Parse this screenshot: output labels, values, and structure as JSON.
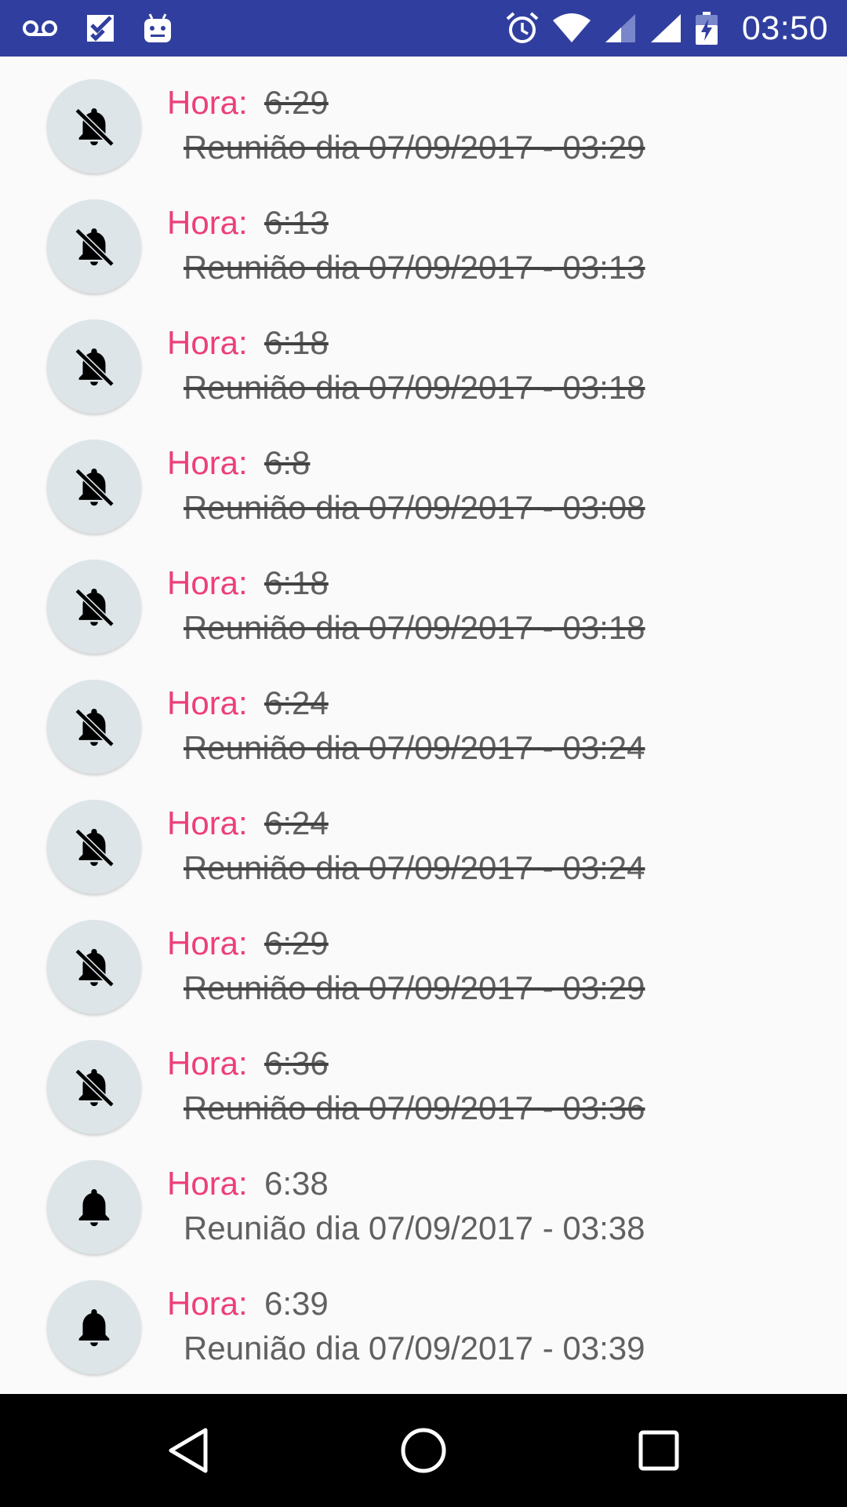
{
  "status_bar": {
    "time": "03:50",
    "left_icons": [
      "voicemail-icon",
      "checklist-icon",
      "android-icon"
    ],
    "right_icons": [
      "alarm-icon",
      "wifi-icon",
      "signal-icon",
      "signal-icon",
      "battery-charging-icon"
    ]
  },
  "colors": {
    "status_bar": "#303f9f",
    "label_accent": "#ec407a",
    "text": "#616161",
    "avatar_bg": "#dde5e8"
  },
  "list": {
    "items": [
      {
        "label": "Hora:",
        "time": "6:29",
        "description": "Reunião dia 07/09/2017 - 03:29",
        "notifications_off": true
      },
      {
        "label": "Hora:",
        "time": "6:13",
        "description": "Reunião dia 07/09/2017 - 03:13",
        "notifications_off": true
      },
      {
        "label": "Hora:",
        "time": "6:18",
        "description": "Reunião dia 07/09/2017 - 03:18",
        "notifications_off": true
      },
      {
        "label": "Hora:",
        "time": "6:8",
        "description": "Reunião dia 07/09/2017 - 03:08",
        "notifications_off": true
      },
      {
        "label": "Hora:",
        "time": "6:18",
        "description": "Reunião dia 07/09/2017 - 03:18",
        "notifications_off": true
      },
      {
        "label": "Hora:",
        "time": "6:24",
        "description": "Reunião dia 07/09/2017 - 03:24",
        "notifications_off": true
      },
      {
        "label": "Hora:",
        "time": "6:24",
        "description": "Reunião dia 07/09/2017 - 03:24",
        "notifications_off": true
      },
      {
        "label": "Hora:",
        "time": "6:29",
        "description": "Reunião dia 07/09/2017 - 03:29",
        "notifications_off": true
      },
      {
        "label": "Hora:",
        "time": "6:36",
        "description": "Reunião dia 07/09/2017 - 03:36",
        "notifications_off": true
      },
      {
        "label": "Hora:",
        "time": "6:38",
        "description": "Reunião dia 07/09/2017 - 03:38",
        "notifications_off": false
      },
      {
        "label": "Hora:",
        "time": "6:39",
        "description": "Reunião dia 07/09/2017 - 03:39",
        "notifications_off": false
      }
    ]
  },
  "nav_bar": {
    "buttons": [
      "back-icon",
      "home-icon",
      "recents-icon"
    ]
  }
}
